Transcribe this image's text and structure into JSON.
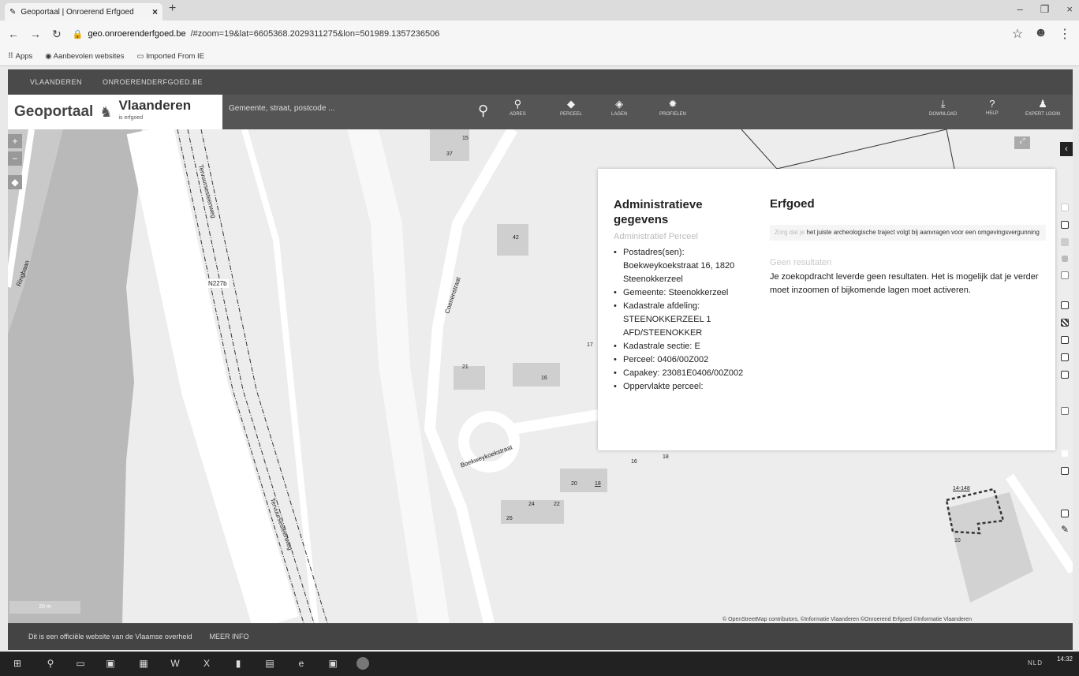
{
  "browser": {
    "tab_title": "Geoportaal | Onroerend Erfgoed",
    "url_host": "geo.onroerenderfgoed.be",
    "url_rest": "/#zoom=19&lat=6605368.2029311275&lon=501989.1357236506",
    "bookmarks": [
      "Apps",
      "Aanbevolen websites",
      "Imported From IE"
    ]
  },
  "topbar": {
    "links": [
      "VLAANDEREN",
      "ONROERENDERFGOED.BE"
    ]
  },
  "header": {
    "brand": "Geoportaal",
    "brand_sub": "Vlaanderen",
    "brand_small": "is erfgoed",
    "search_placeholder": "Gemeente, straat, postcode ...",
    "tools": [
      {
        "label": "ADRES",
        "icon": "pin-icon"
      },
      {
        "label": "PERCEEL",
        "icon": "parcel-icon"
      },
      {
        "label": "LAGEN",
        "icon": "layers-icon"
      },
      {
        "label": "PROFIELEN",
        "icon": "profiles-icon"
      },
      {
        "label": "DOWNLOAD",
        "icon": "download-icon"
      },
      {
        "label": "HELP",
        "icon": "help-icon"
      },
      {
        "label": "EXPERT LOGIN",
        "icon": "user-icon"
      }
    ]
  },
  "map": {
    "labels": {
      "tervuursesteenweg": "Tervuursesteenweg",
      "n227b": "N227b",
      "ringbaan": "Ringbaan",
      "coenenstraat": "Coenenstraat",
      "boekweykoekstraat": "Boekweykoekstraat",
      "h37": "37",
      "h15": "15",
      "h42": "42",
      "h17": "17",
      "h21": "21",
      "h16a": "16",
      "h16b": "16",
      "h18": "18",
      "h20": "20",
      "h24": "24",
      "h22": "22",
      "h26": "26",
      "h10": "10",
      "h1448": "14-148"
    },
    "scale": "20 m",
    "attribution": "© OpenStreetMap contributors, ©Informatie Vlaanderen ©Onroerend Erfgoed ©Informatie Vlaanderen"
  },
  "panel": {
    "admin_title": "Administratieve gegevens",
    "admin_subtitle": "Administratief Perceel",
    "items": [
      "Postadres(sen): Boekweykoekstraat 16, 1820 Steenokkerzeel",
      "Gemeente: Steenokkerzeel",
      "Kadastrale afdeling: STEENOKKERZEEL 1 AFD/STEENOKKER",
      "Kadastrale sectie: E",
      "Perceel: 0406/00Z002",
      "Capakey: 23081E0406/00Z002",
      "Oppervlakte perceel:"
    ],
    "erfgoed_title": "Erfgoed",
    "note_link": "Zorg dat je",
    "note_text": "het juiste archeologische traject volgt bij aanvragen voor een omgevingsvergunning",
    "no_results_title": "Geen resultaten",
    "no_results_text": "Je zoekopdracht leverde geen resultaten. Het is mogelijk dat je verder moet inzoomen of bijkomende lagen moet activeren."
  },
  "footer": {
    "text": "Dit is een officiële website van de Vlaamse overheid",
    "more": "MEER INFO"
  },
  "taskbar": {
    "tray": "NLD",
    "time": "14:32"
  }
}
